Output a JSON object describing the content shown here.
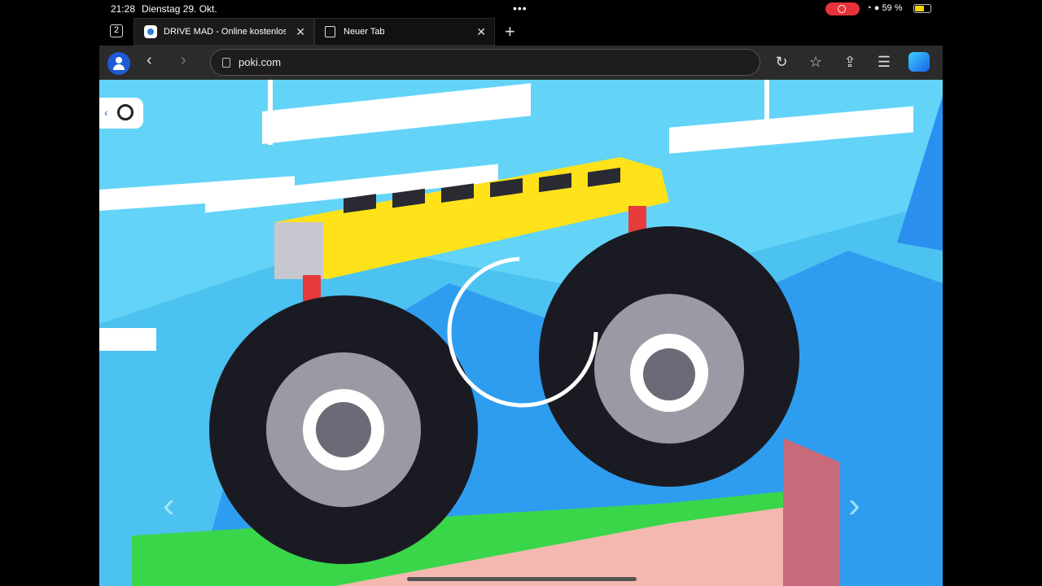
{
  "status_bar": {
    "time": "21:28",
    "date": "Dienstag 29. Okt.",
    "battery": "59 %"
  },
  "tab_bar": {
    "tab_count": "2",
    "tabs": [
      {
        "title": "DRIVE MAD - Online kostenlos"
      },
      {
        "title": "Neuer Tab"
      }
    ]
  },
  "address_bar": {
    "url": "poki.com"
  },
  "colors": {
    "sky": "#63d4f7",
    "bus": "#ffe21a",
    "tire": "#1a1a22",
    "grass": "#3ad64a",
    "dirt": "#f4b8b0"
  },
  "icons": [
    "back-icon",
    "forward-icon",
    "reload-icon",
    "favorites-icon",
    "share-icon",
    "menu-icon",
    "copilot-icon",
    "new-tab-icon",
    "close-tab-icon"
  ]
}
